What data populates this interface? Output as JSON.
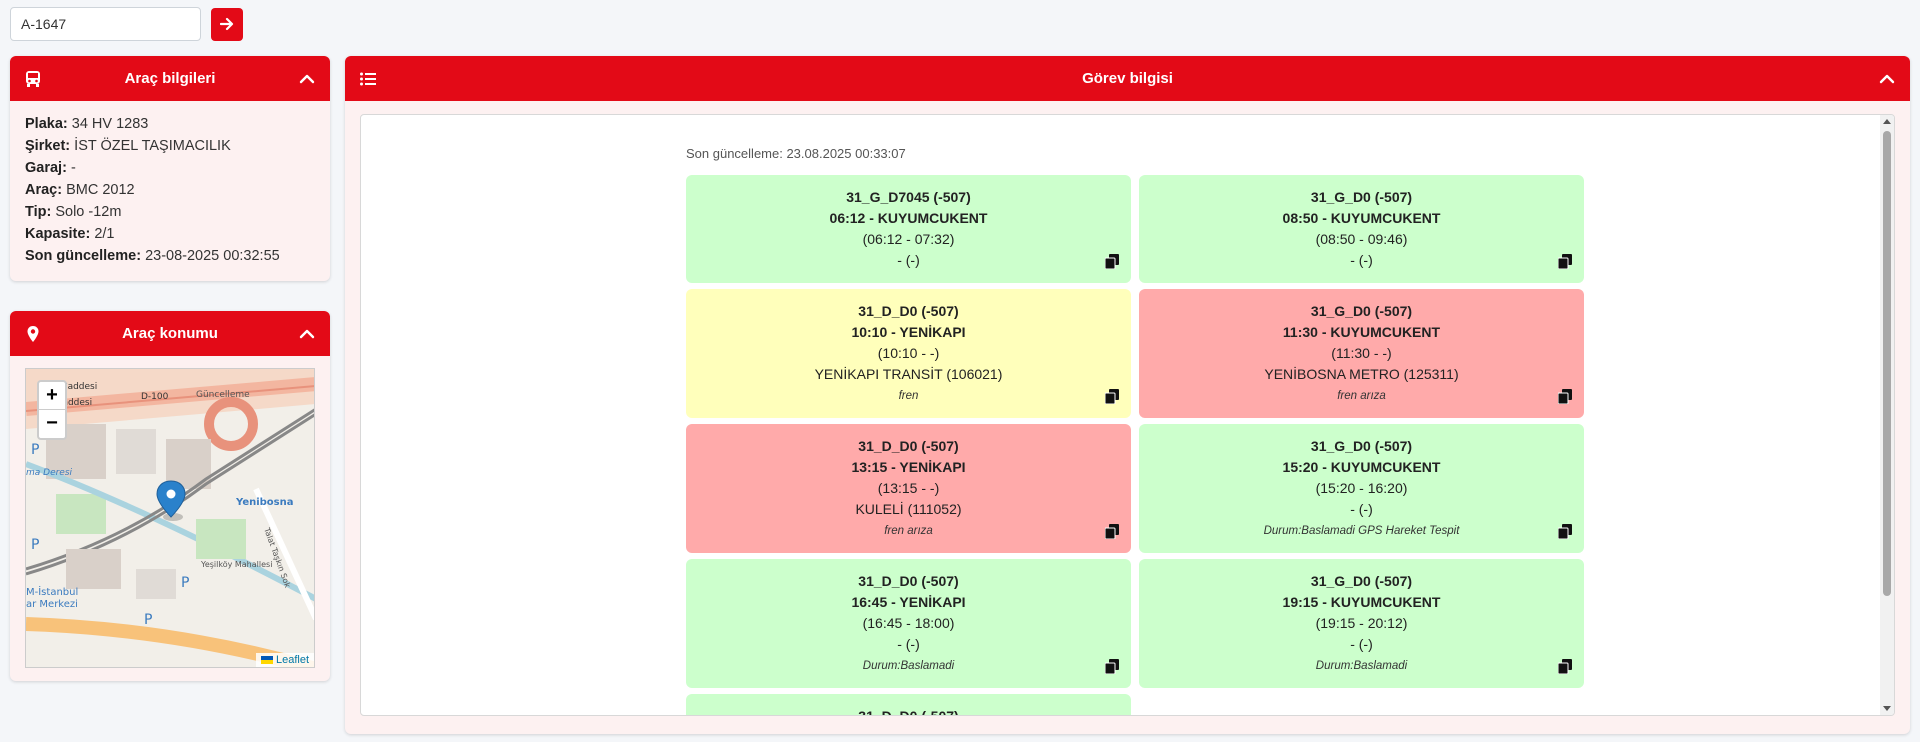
{
  "search": {
    "value": "A-1647"
  },
  "vehicle": {
    "title": "Araç bilgileri",
    "fields": [
      {
        "label": "Plaka:",
        "value": "34 HV 1283"
      },
      {
        "label": "Şirket:",
        "value": "İST ÖZEL TAŞIMACILIK"
      },
      {
        "label": "Garaj:",
        "value": "-"
      },
      {
        "label": "Araç:",
        "value": "BMC 2012"
      },
      {
        "label": "Tip:",
        "value": "Solo -12m"
      },
      {
        "label": "Kapasite:",
        "value": "2/1"
      },
      {
        "label": "Son güncelleme:",
        "value": "23-08-2025 00:32:55"
      }
    ]
  },
  "location": {
    "title": "Araç konumu",
    "zoom_in": "+",
    "zoom_out": "−",
    "attribution": "Leaflet",
    "map_labels": [
      "D-100",
      "Yenibosna",
      "Güncelleme",
      "Yeşilköy Mahallesi",
      "M-İstanbul",
      "ar Merkezi",
      "Kuyumcular Yolu Caddesi",
      "P",
      "P",
      "P",
      "P",
      "Yol Caddesi",
      "ınar Caddesi",
      "Talat Taşkın Sok",
      "ma Deresi"
    ]
  },
  "tasks": {
    "title": "Görev bilgisi",
    "last_update": "Son güncelleme: 23.08.2025 00:33:07",
    "items": [
      {
        "code": "31_G_D7045 (-507)",
        "time": "06:12 - KUYUMCUKENT",
        "range": "(06:12 - 07:32)",
        "stop": "- (-)",
        "note": "",
        "color": "green"
      },
      {
        "code": "31_G_D0 (-507)",
        "time": "08:50 - KUYUMCUKENT",
        "range": "(08:50 - 09:46)",
        "stop": "- (-)",
        "note": "",
        "color": "green"
      },
      {
        "code": "31_D_D0 (-507)",
        "time": "10:10 - YENİKAPI",
        "range": "(10:10 - -)",
        "stop": "YENİKAPI TRANSİT (106021)",
        "note": "fren",
        "color": "yellow"
      },
      {
        "code": "31_G_D0 (-507)",
        "time": "11:30 - KUYUMCUKENT",
        "range": "(11:30 - -)",
        "stop": "YENİBOSNA METRO (125311)",
        "note": "fren arıza",
        "color": "red"
      },
      {
        "code": "31_D_D0 (-507)",
        "time": "13:15 - YENİKAPI",
        "range": "(13:15 - -)",
        "stop": "KULELİ (111052)",
        "note": "fren arıza",
        "color": "red"
      },
      {
        "code": "31_G_D0 (-507)",
        "time": "15:20 - KUYUMCUKENT",
        "range": "(15:20 - 16:20)",
        "stop": "- (-)",
        "note": "Durum:Baslamadi GPS Hareket Tespit",
        "color": "green"
      },
      {
        "code": "31_D_D0 (-507)",
        "time": "16:45 - YENİKAPI",
        "range": "(16:45 - 18:00)",
        "stop": "- (-)",
        "note": "Durum:Baslamadi",
        "color": "green"
      },
      {
        "code": "31_G_D0 (-507)",
        "time": "19:15 - KUYUMCUKENT",
        "range": "(19:15 - 20:12)",
        "stop": "- (-)",
        "note": "Durum:Baslamadi",
        "color": "green"
      },
      {
        "code": "31_D_D0 (-507)",
        "time": "",
        "range": "",
        "stop": "",
        "note": "",
        "color": "green"
      }
    ]
  }
}
